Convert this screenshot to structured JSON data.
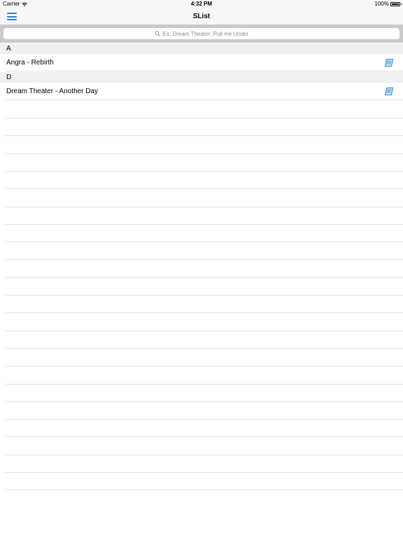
{
  "status_bar": {
    "carrier": "Carrier",
    "time": "4:32 PM",
    "battery": "100%"
  },
  "nav": {
    "title": "SList",
    "menu_icon": "hamburger-menu-icon"
  },
  "search": {
    "placeholder": "Ex; Dream Theater: Pull me Under"
  },
  "sections": [
    {
      "header": "A",
      "rows": [
        {
          "label": "Angra - Rebirth",
          "icon": "lyrics-sheet-icon"
        }
      ]
    },
    {
      "header": "D",
      "rows": [
        {
          "label": "Dream Theater - Another Day",
          "icon": "lyrics-sheet-icon"
        }
      ]
    }
  ],
  "colors": {
    "accent": "#2a7fd4",
    "section_background": "#f0f0f0",
    "search_background": "#c9c9ce"
  }
}
